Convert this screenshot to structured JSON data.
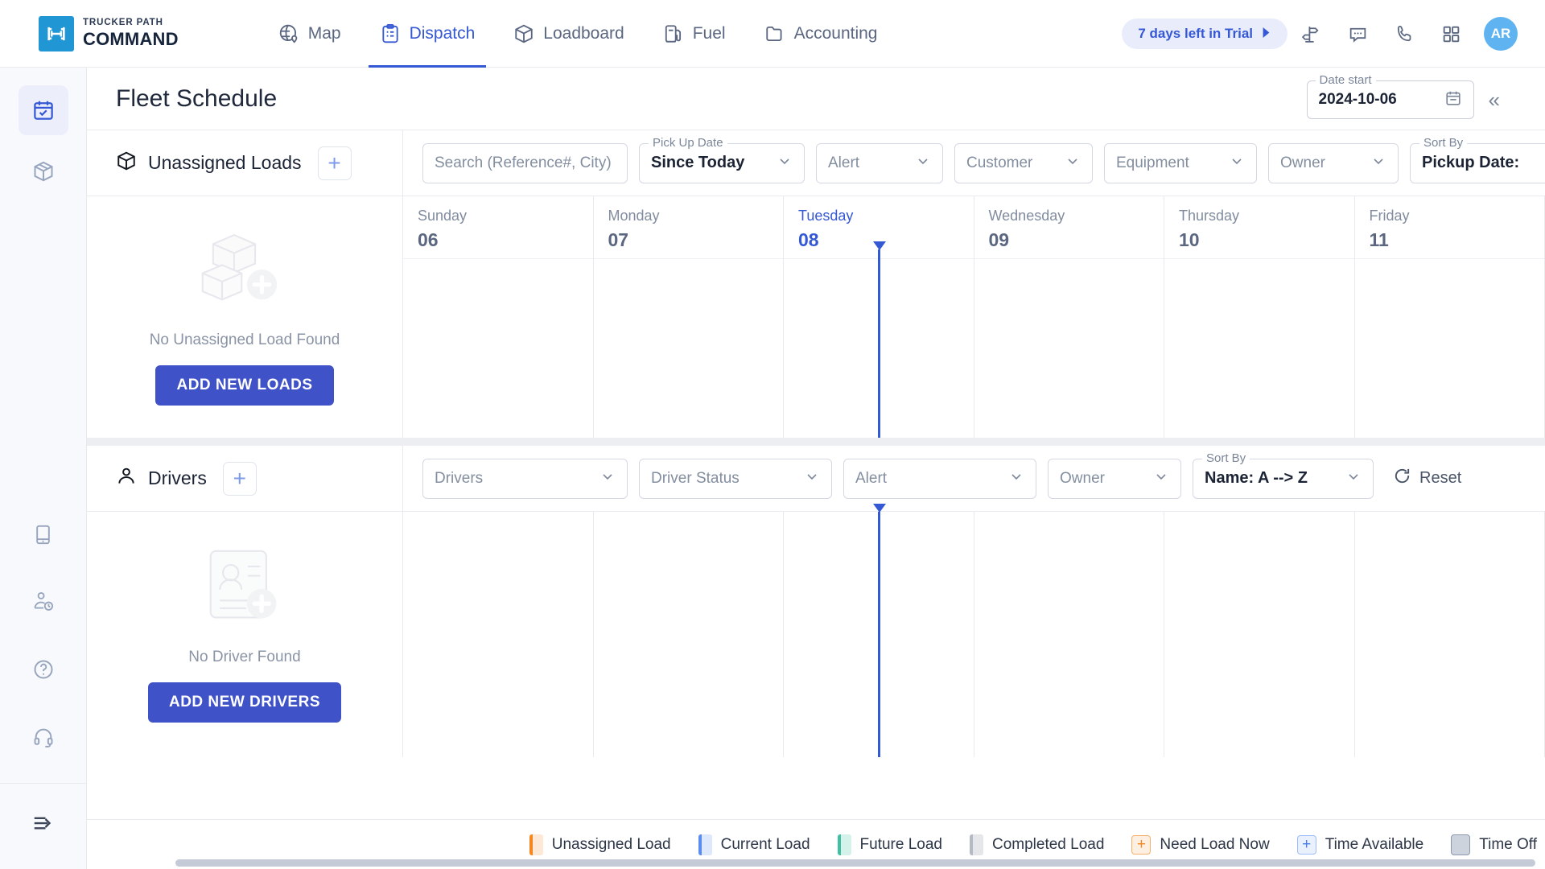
{
  "brand": {
    "top": "TRUCKER PATH",
    "bottom": "COMMAND"
  },
  "nav": {
    "items": [
      {
        "label": "Map",
        "icon": "globe-pin-icon",
        "active": false
      },
      {
        "label": "Dispatch",
        "icon": "clipboard-list-icon",
        "active": true
      },
      {
        "label": "Loadboard",
        "icon": "box-icon",
        "active": false
      },
      {
        "label": "Fuel",
        "icon": "fuel-pump-icon",
        "active": false
      },
      {
        "label": "Accounting",
        "icon": "folder-icon",
        "active": false
      }
    ],
    "trial_badge": "7 days left in Trial",
    "icons": [
      "signpost-icon",
      "chat-bubble-icon",
      "phone-icon",
      "grid-apps-icon"
    ],
    "avatar_initials": "AR"
  },
  "rail": {
    "top_items": [
      {
        "name": "calendar-check-icon",
        "active": true
      },
      {
        "name": "box-icon",
        "active": false
      }
    ],
    "bottom_items": [
      {
        "name": "tablet-icon"
      },
      {
        "name": "driver-hours-icon"
      },
      {
        "name": "help-circle-icon"
      },
      {
        "name": "headset-icon"
      }
    ],
    "expand_icon": "expand-arrow-icon"
  },
  "page": {
    "title": "Fleet Schedule",
    "date_start_label": "Date start",
    "date_start_value": "2024-10-06",
    "calendar_icon": "calendar-icon",
    "collapse_icon": "chevron-double-left-icon"
  },
  "loads": {
    "section_title": "Unassigned Loads",
    "section_icon": "box-icon",
    "add_label": "+",
    "search_placeholder": "Search (Reference#, City)",
    "pickup_date_label": "Pick Up Date",
    "pickup_date_value": "Since Today",
    "alert_placeholder": "Alert",
    "customer_placeholder": "Customer",
    "equipment_placeholder": "Equipment",
    "owner_placeholder": "Owner",
    "sort_by_label": "Sort By",
    "sort_by_value": "Pickup Date:",
    "empty_text": "No Unassigned Load Found",
    "empty_icon": "boxes-add-icon",
    "add_button": "ADD NEW LOADS"
  },
  "drivers": {
    "section_title": "Drivers",
    "section_icon": "driver-icon",
    "add_label": "+",
    "drivers_placeholder": "Drivers",
    "status_placeholder": "Driver Status",
    "alert_placeholder": "Alert",
    "owner_placeholder": "Owner",
    "sort_by_label": "Sort By",
    "sort_by_value": "Name: A --> Z",
    "reset_label": "Reset",
    "reset_icon": "refresh-icon",
    "empty_text": "No Driver Found",
    "empty_icon": "driver-card-add-icon",
    "add_button": "ADD NEW DRIVERS"
  },
  "calendar": {
    "days": [
      {
        "name": "Sunday",
        "num": "06",
        "today": false
      },
      {
        "name": "Monday",
        "num": "07",
        "today": false
      },
      {
        "name": "Tuesday",
        "num": "08",
        "today": true
      },
      {
        "name": "Wednesday",
        "num": "09",
        "today": false
      },
      {
        "name": "Thursday",
        "num": "10",
        "today": false
      },
      {
        "name": "Friday",
        "num": "11",
        "today": false
      }
    ]
  },
  "legend": {
    "items": [
      {
        "label": "Unassigned Load",
        "type": "bar",
        "bar": "#f5861f",
        "fill": "#fde8d6"
      },
      {
        "label": "Current Load",
        "type": "bar",
        "bar": "#5b8def",
        "fill": "#dde8fc"
      },
      {
        "label": "Future Load",
        "type": "bar",
        "bar": "#3fc0a5",
        "fill": "#d5f2ea"
      },
      {
        "label": "Completed Load",
        "type": "bar",
        "bar": "#b4bac4",
        "fill": "#e4e6ea"
      },
      {
        "label": "Need Load Now",
        "type": "plus",
        "bar": "#f5861f",
        "fill": "#fdf0e3"
      },
      {
        "label": "Time Available",
        "type": "plus",
        "bar": "#5b8def",
        "fill": "#eaf1fe"
      },
      {
        "label": "Time Off",
        "type": "bar2",
        "bar": "#8d99ad",
        "fill": "#ccd3dd"
      }
    ]
  },
  "colors": {
    "accent": "#3558d4",
    "brand": "#2196d4",
    "primary_button": "#3f52c7"
  }
}
